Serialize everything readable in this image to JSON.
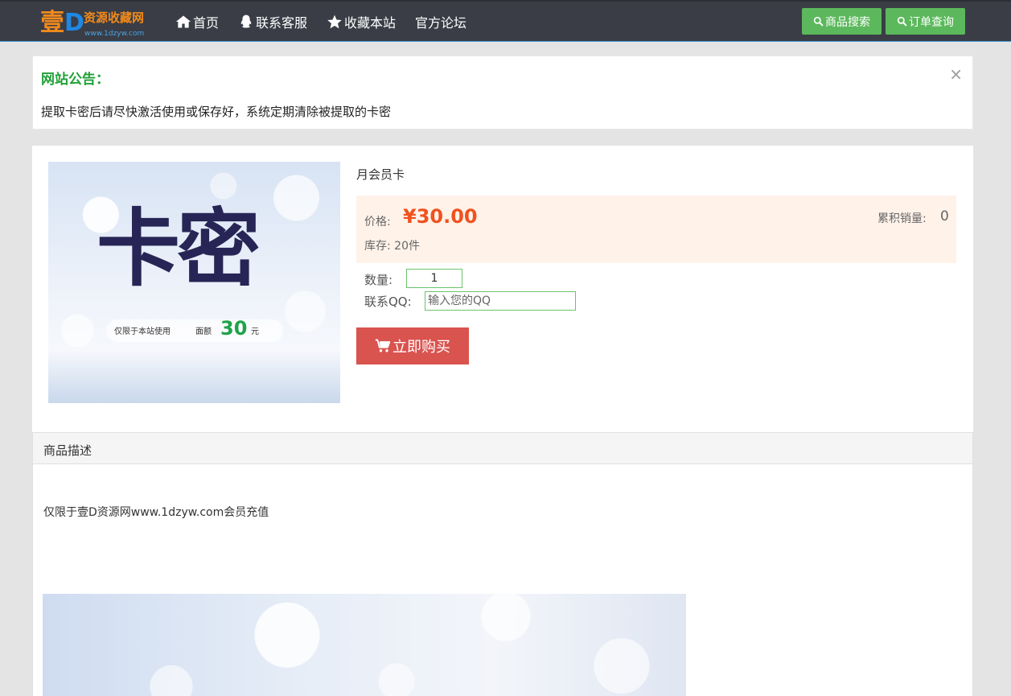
{
  "logo": {
    "big_char": "壹",
    "big_letter": "D",
    "name": "资源收藏网",
    "url": "www.1dzyw.com"
  },
  "nav": {
    "items": [
      {
        "label": "首页",
        "icon": "home-icon"
      },
      {
        "label": "联系客服",
        "icon": "qq-penguin-icon"
      },
      {
        "label": "收藏本站",
        "icon": "star-icon"
      },
      {
        "label": "官方论坛",
        "icon": ""
      }
    ],
    "search_button": "商品搜索",
    "order_button": "订单查询"
  },
  "notice": {
    "title": "网站公告：",
    "close": "×",
    "text": "提取卡密后请尽快激活使用或保存好，系统定期清除被提取的卡密"
  },
  "product": {
    "image": {
      "big_text": "卡密",
      "small_text_1": "仅限于本站使用",
      "small_text_2": "面额",
      "amount": "30",
      "unit": "元"
    },
    "name": "月会员卡",
    "price_label": "价格:",
    "price": "¥30.00",
    "stock": "库存: 20件",
    "sales_label": "累积销量:",
    "sales_value": "0",
    "quantity_label": "数量:",
    "quantity_value": "1",
    "qq_label": "联系QQ:",
    "qq_placeholder": "输入您的QQ",
    "buy_button": "立即购买"
  },
  "description": {
    "title": "商品描述",
    "text": "仅限于壹D资源网www.1dzyw.com会员充值"
  },
  "colors": {
    "navbar": "#3a3d46",
    "green_button": "#5cb85c",
    "buy_button": "#d9534f",
    "price": "#f0521f",
    "notice_title": "#21a038"
  }
}
